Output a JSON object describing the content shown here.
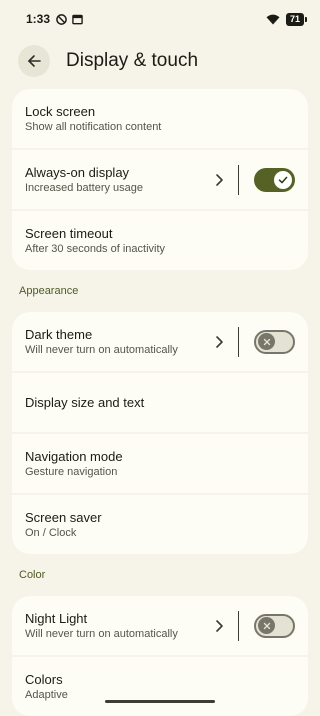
{
  "status_bar": {
    "time": "1:33",
    "battery": "71"
  },
  "app_bar": {
    "title": "Display & touch"
  },
  "group1": [
    {
      "title": "Lock screen",
      "summary": "Show all notification content"
    },
    {
      "title": "Always-on display",
      "summary": "Increased battery usage",
      "switch": "on"
    },
    {
      "title": "Screen timeout",
      "summary": "After 30 seconds of inactivity"
    }
  ],
  "appearance": {
    "header": "Appearance",
    "items": [
      {
        "title": "Dark theme",
        "summary": "Will never turn on automatically",
        "switch": "off"
      },
      {
        "title": "Display size and text"
      },
      {
        "title": "Navigation mode",
        "summary": "Gesture navigation"
      },
      {
        "title": "Screen saver",
        "summary": "On / Clock"
      }
    ]
  },
  "color": {
    "header": "Color",
    "items": [
      {
        "title": "Night Light",
        "summary": "Will never turn on automatically",
        "switch": "off"
      },
      {
        "title": "Colors",
        "summary": "Adaptive"
      }
    ]
  },
  "colors": {
    "accent": "#546325",
    "background": "#f6f4e8",
    "card": "#fdfcf5"
  }
}
